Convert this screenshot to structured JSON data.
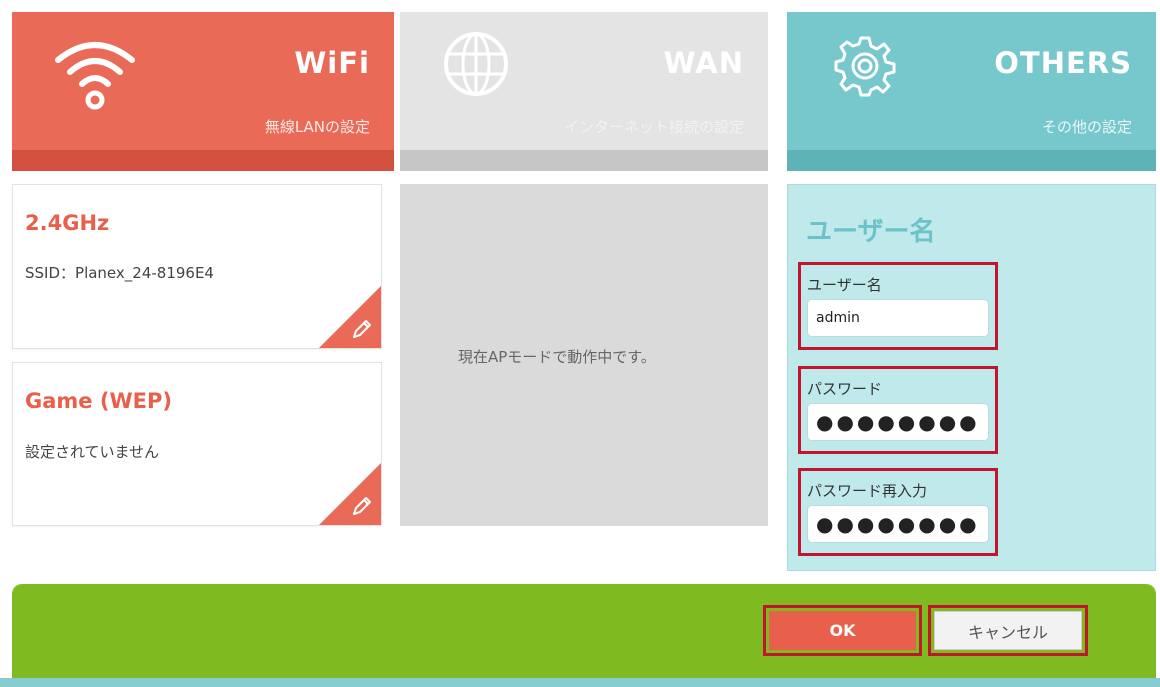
{
  "tabs": {
    "wifi": {
      "title": "WiFi",
      "subtitle": "無線LANの設定",
      "icon": "wifi-icon",
      "color": "#ea6a58"
    },
    "wan": {
      "title": "WAN",
      "subtitle": "インターネット接続の設定",
      "icon": "globe-icon",
      "color": "#e4e4e4"
    },
    "others": {
      "title": "OTHERS",
      "subtitle": "その他の設定",
      "icon": "gear-icon",
      "color": "#77c8cc"
    }
  },
  "wifi_cards": {
    "band24": {
      "title": "2.4GHz",
      "text": "SSID：Planex_24-8196E4",
      "edit_icon": "pencil-icon"
    },
    "game": {
      "title": "Game (WEP)",
      "text": "設定されていません",
      "edit_icon": "pencil-icon"
    }
  },
  "wan_panel": {
    "message": "現在APモードで動作中です。"
  },
  "others_panel": {
    "title": "ユーザー名",
    "username": {
      "label": "ユーザー名",
      "value": "admin"
    },
    "password": {
      "label": "パスワード",
      "value": "●●●●●●●●●●●"
    },
    "password_confirm": {
      "label": "パスワード再入力",
      "value": "●●●●●●●●●●●"
    }
  },
  "footer": {
    "ok_label": "OK",
    "cancel_label": "キャンセル",
    "bar_color": "#7dbb21"
  }
}
